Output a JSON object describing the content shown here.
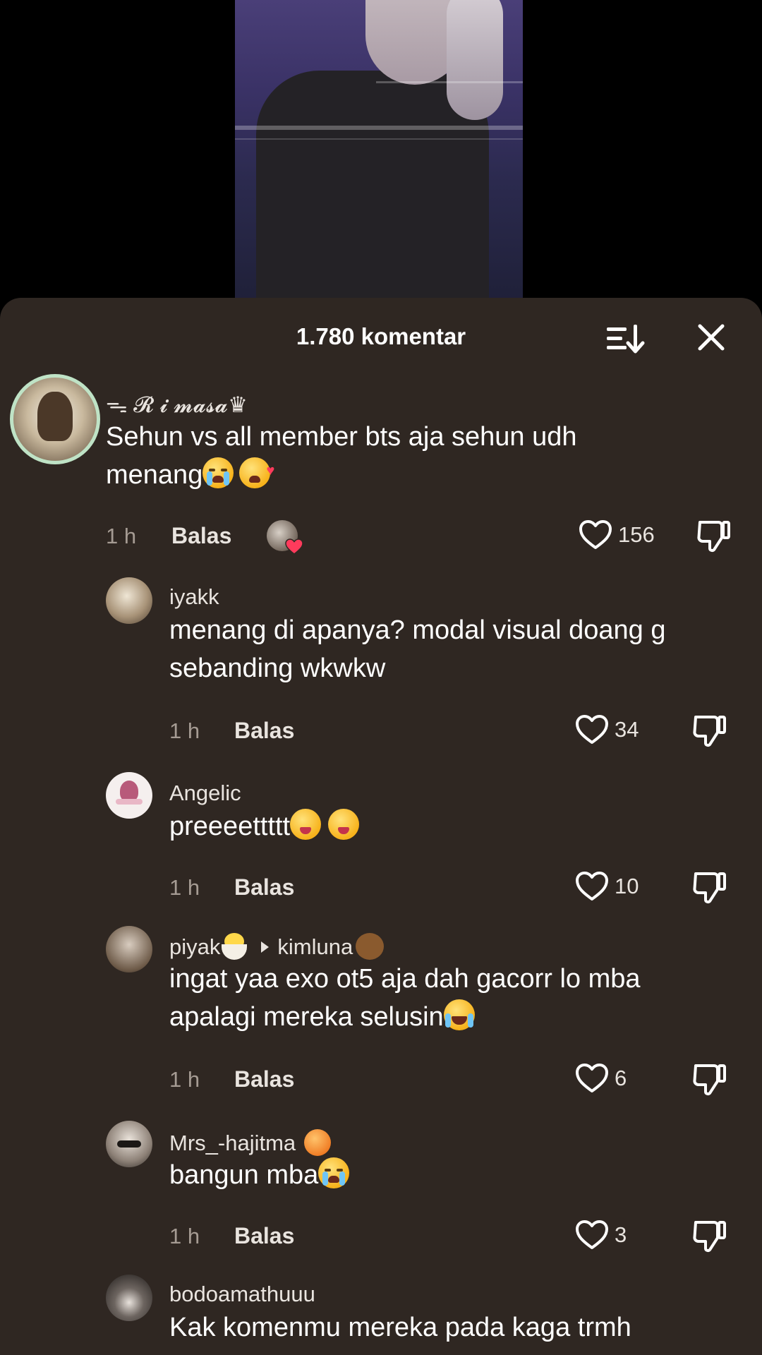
{
  "sheet": {
    "title": "1.780 komentar",
    "sort_icon": "sort-icon",
    "close_icon": "close-icon"
  },
  "comments": [
    {
      "username": "ᯓ 𝓡 𝓲 𝓶𝓪𝓼𝓪♛",
      "text": "Sehun vs all member bts aja sehun udh menang",
      "time": "1 h",
      "reply_label": "Balas",
      "likes": "156",
      "liked_by_creator": true
    },
    {
      "username": "iyakk",
      "text_line1": "menang di apanya? modal visual doang g",
      "text_line2": "sebanding wkwkw",
      "time": "1 h",
      "reply_label": "Balas",
      "likes": "34"
    },
    {
      "username": "Angelic",
      "text": "preeeettttt",
      "time": "1 h",
      "reply_label": "Balas",
      "likes": "10"
    },
    {
      "username": "piyak",
      "reply_to": "kimluna",
      "text_line1": "ingat yaa exo ot5 aja dah gacorr lo mba",
      "text_line2": "apalagi mereka selusin",
      "time": "1 h",
      "reply_label": "Balas",
      "likes": "6"
    },
    {
      "username": "Mrs_-hajitma",
      "text": "bangun mba",
      "time": "1 h",
      "reply_label": "Balas",
      "likes": "3"
    },
    {
      "username": "bodoamathuuu",
      "text": "Kak komenmu mereka pada kaga trmh"
    }
  ],
  "colors": {
    "sheet_bg": "#2f2722",
    "like_heart": "#ff3b5c"
  }
}
